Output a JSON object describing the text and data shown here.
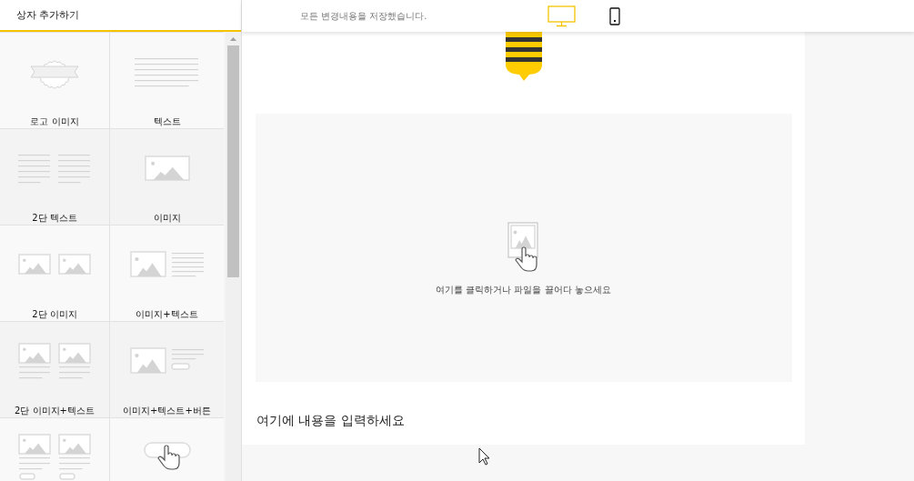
{
  "sidebar": {
    "title": "상자 추가하기",
    "tiles": [
      {
        "kind": "logo",
        "label": "로고 이미지"
      },
      {
        "kind": "text",
        "label": "텍스트"
      },
      {
        "kind": "text2",
        "label": "2단 텍스트"
      },
      {
        "kind": "image",
        "label": "이미지"
      },
      {
        "kind": "image2",
        "label": "2단 이미지"
      },
      {
        "kind": "imagetext",
        "label": "이미지+텍스트"
      },
      {
        "kind": "image2text",
        "label": "2단 이미지+텍스트"
      },
      {
        "kind": "imagetextbutton",
        "label": "이미지+텍스트+버튼"
      },
      {
        "kind": "image2textbutton"
      },
      {
        "kind": "button"
      }
    ]
  },
  "topbar": {
    "status": "모든 변경내용을 저장했습니다.",
    "devices": [
      {
        "kind": "desktop",
        "selected": true
      },
      {
        "kind": "mobile",
        "selected": false
      }
    ]
  },
  "editor": {
    "dropzone": {
      "hint": "여기를 클릭하거나 파일을 끌어다 놓으세요"
    },
    "body": {
      "placeholder": "여기에 내용을 입력하세요"
    }
  }
}
